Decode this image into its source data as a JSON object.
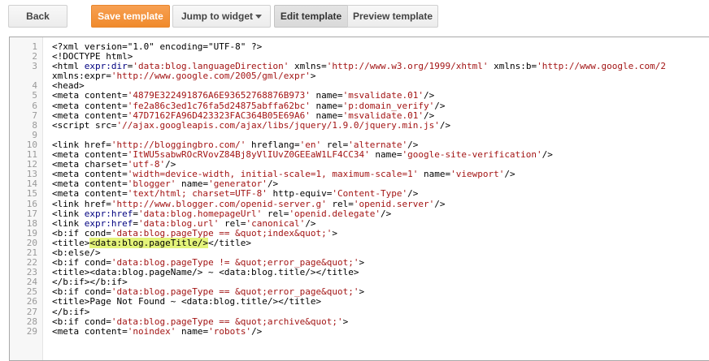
{
  "toolbar": {
    "back_label": "Back",
    "save_label": "Save template",
    "jump_label": "Jump to widget",
    "edit_label": "Edit template",
    "preview_label": "Preview template"
  },
  "colors": {
    "save_button": "#f08a2c",
    "attribute": "#000080",
    "value": "#a31515",
    "highlight": "#e4f47a"
  },
  "editor": {
    "lines": [
      {
        "num": "1",
        "segments": [
          [
            "t",
            "<?xml version=\"1.0\" encoding=\"UTF-8\" ?>"
          ]
        ]
      },
      {
        "num": "2",
        "segments": [
          [
            "t",
            "<!DOCTYPE html>"
          ]
        ]
      },
      {
        "num": "3",
        "segments": [
          [
            "t",
            "<html "
          ],
          [
            "a",
            "expr:dir"
          ],
          [
            "t",
            "="
          ],
          [
            "v",
            "'data:blog.languageDirection'"
          ],
          [
            "t",
            " xmlns="
          ],
          [
            "v",
            "'http://www.w3.org/1999/xhtml'"
          ],
          [
            "t",
            " xmlns:b="
          ],
          [
            "v",
            "'http://www.google.com/2"
          ]
        ]
      },
      {
        "num": "",
        "segments": [
          [
            "t",
            "xmlns:expr="
          ],
          [
            "v",
            "'http://www.google.com/2005/gml/expr'"
          ],
          [
            "t",
            ">"
          ]
        ]
      },
      {
        "num": "4",
        "segments": [
          [
            "t",
            "<head>"
          ]
        ]
      },
      {
        "num": "5",
        "segments": [
          [
            "t",
            "<meta content="
          ],
          [
            "v",
            "'4879E322491876A6E93652768876B973'"
          ],
          [
            "t",
            " name="
          ],
          [
            "v",
            "'msvalidate.01'"
          ],
          [
            "t",
            "/>"
          ]
        ]
      },
      {
        "num": "6",
        "segments": [
          [
            "t",
            "<meta content="
          ],
          [
            "v",
            "'fe2a86c3ed1c76fa5d24875abffa62bc'"
          ],
          [
            "t",
            " name="
          ],
          [
            "v",
            "'p:domain_verify'"
          ],
          [
            "t",
            "/>"
          ]
        ]
      },
      {
        "num": "7",
        "segments": [
          [
            "t",
            "<meta content="
          ],
          [
            "v",
            "'47D7162FA96D423323FAC364B05E69A6'"
          ],
          [
            "t",
            " name="
          ],
          [
            "v",
            "'msvalidate.01'"
          ],
          [
            "t",
            "/>"
          ]
        ]
      },
      {
        "num": "8",
        "segments": [
          [
            "t",
            "<script src="
          ],
          [
            "v",
            "'//ajax.googleapis.com/ajax/libs/jquery/1.9.0/jquery.min.js'"
          ],
          [
            "t",
            "/>"
          ]
        ]
      },
      {
        "num": "9",
        "segments": []
      },
      {
        "num": "10",
        "segments": [
          [
            "t",
            "<link href="
          ],
          [
            "v",
            "'http://bloggingbro.com/'"
          ],
          [
            "t",
            " hreflang="
          ],
          [
            "v",
            "'en'"
          ],
          [
            "t",
            " rel="
          ],
          [
            "v",
            "'alternate'"
          ],
          [
            "t",
            "/>"
          ]
        ]
      },
      {
        "num": "11",
        "segments": [
          [
            "t",
            "<meta content="
          ],
          [
            "v",
            "'ItWU5sabwROcRVovZ84Bj8yVlIUvZ0GEEaW1LF4CC34'"
          ],
          [
            "t",
            " name="
          ],
          [
            "v",
            "'google-site-verification'"
          ],
          [
            "t",
            "/>"
          ]
        ]
      },
      {
        "num": "12",
        "segments": [
          [
            "t",
            "<meta charset="
          ],
          [
            "v",
            "'utf-8'"
          ],
          [
            "t",
            "/>"
          ]
        ]
      },
      {
        "num": "13",
        "segments": [
          [
            "t",
            "<meta content="
          ],
          [
            "v",
            "'width=device-width, initial-scale=1, maximum-scale=1'"
          ],
          [
            "t",
            " name="
          ],
          [
            "v",
            "'viewport'"
          ],
          [
            "t",
            "/>"
          ]
        ]
      },
      {
        "num": "14",
        "segments": [
          [
            "t",
            "<meta content="
          ],
          [
            "v",
            "'blogger'"
          ],
          [
            "t",
            " name="
          ],
          [
            "v",
            "'generator'"
          ],
          [
            "t",
            "/>"
          ]
        ]
      },
      {
        "num": "15",
        "segments": [
          [
            "t",
            "<meta content="
          ],
          [
            "v",
            "'text/html; charset=UTF-8'"
          ],
          [
            "t",
            " http-equiv="
          ],
          [
            "v",
            "'Content-Type'"
          ],
          [
            "t",
            "/>"
          ]
        ]
      },
      {
        "num": "16",
        "segments": [
          [
            "t",
            "<link href="
          ],
          [
            "v",
            "'http://www.blogger.com/openid-server.g'"
          ],
          [
            "t",
            " rel="
          ],
          [
            "v",
            "'openid.server'"
          ],
          [
            "t",
            "/>"
          ]
        ]
      },
      {
        "num": "17",
        "segments": [
          [
            "t",
            "<link "
          ],
          [
            "a",
            "expr:href"
          ],
          [
            "t",
            "="
          ],
          [
            "v",
            "'data:blog.homepageUrl'"
          ],
          [
            "t",
            " rel="
          ],
          [
            "v",
            "'openid.delegate'"
          ],
          [
            "t",
            "/>"
          ]
        ]
      },
      {
        "num": "18",
        "segments": [
          [
            "t",
            "<link "
          ],
          [
            "a",
            "expr:href"
          ],
          [
            "t",
            "="
          ],
          [
            "v",
            "'data:blog.url'"
          ],
          [
            "t",
            " rel="
          ],
          [
            "v",
            "'canonical'"
          ],
          [
            "t",
            "/>"
          ]
        ]
      },
      {
        "num": "19",
        "segments": [
          [
            "t",
            "<b:if cond="
          ],
          [
            "v",
            "'data:blog.pageType == &quot;index&quot;'"
          ],
          [
            "t",
            ">"
          ]
        ]
      },
      {
        "num": "20",
        "segments": [
          [
            "t",
            "<title>"
          ],
          [
            "h",
            "<data:blog.pageTitle/>"
          ],
          [
            "t",
            "</title>"
          ]
        ]
      },
      {
        "num": "21",
        "segments": [
          [
            "t",
            "<b:else/>"
          ]
        ]
      },
      {
        "num": "22",
        "segments": [
          [
            "t",
            "<b:if cond="
          ],
          [
            "v",
            "'data:blog.pageType != &quot;error_page&quot;'"
          ],
          [
            "t",
            ">"
          ]
        ]
      },
      {
        "num": "23",
        "segments": [
          [
            "t",
            "<title><data:blog.pageName/> ~ <data:blog.title/></title>"
          ]
        ]
      },
      {
        "num": "24",
        "segments": [
          [
            "t",
            "</b:if></b:if>"
          ]
        ]
      },
      {
        "num": "25",
        "segments": [
          [
            "t",
            "<b:if cond="
          ],
          [
            "v",
            "'data:blog.pageType == &quot;error_page&quot;'"
          ],
          [
            "t",
            ">"
          ]
        ]
      },
      {
        "num": "26",
        "segments": [
          [
            "t",
            "<title>Page Not Found ~ <data:blog.title/></title>"
          ]
        ]
      },
      {
        "num": "27",
        "segments": [
          [
            "t",
            "</b:if>"
          ]
        ]
      },
      {
        "num": "28",
        "segments": [
          [
            "t",
            "<b:if cond="
          ],
          [
            "v",
            "'data:blog.pageType == &quot;archive&quot;'"
          ],
          [
            "t",
            ">"
          ]
        ]
      },
      {
        "num": "29",
        "segments": [
          [
            "t",
            "<meta content="
          ],
          [
            "v",
            "'noindex'"
          ],
          [
            "t",
            " name="
          ],
          [
            "v",
            "'robots'"
          ],
          [
            "t",
            "/>"
          ]
        ]
      }
    ]
  }
}
